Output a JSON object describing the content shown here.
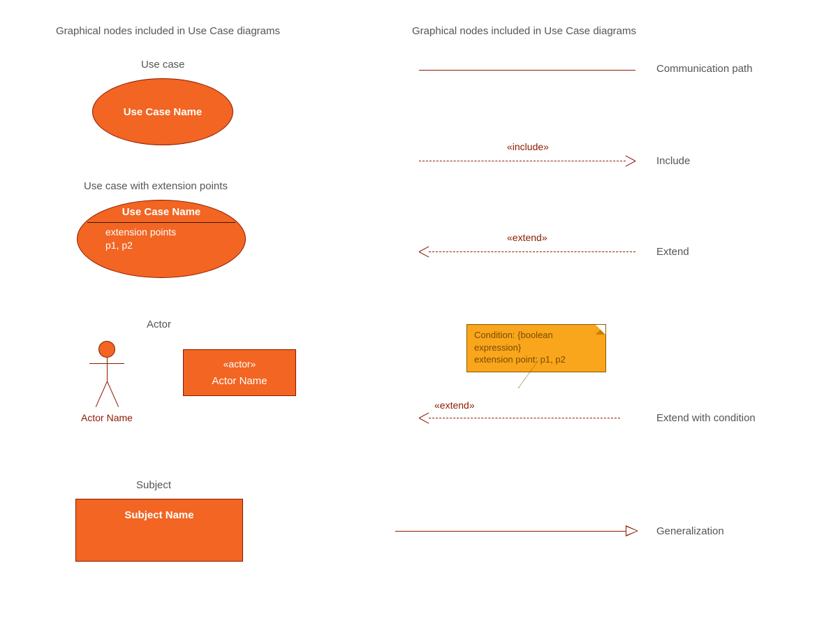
{
  "headings": {
    "left": "Graphical nodes included in Use Case diagrams",
    "right": "Graphical nodes included in Use Case diagrams"
  },
  "left_items": {
    "use_case": {
      "title": "Use case",
      "name": "Use Case Name"
    },
    "use_case_ext": {
      "title": "Use case with extension points",
      "name": "Use Case Name",
      "ext_label": "extension points",
      "ext_list": "p1, p2"
    },
    "actor": {
      "title": "Actor",
      "stick_caption": "Actor Name",
      "stereotype": "«actor»",
      "rect_name": "Actor Name"
    },
    "subject": {
      "title": "Subject",
      "name": "Subject Name"
    }
  },
  "right_items": {
    "communication": {
      "label": "Communication path"
    },
    "include": {
      "stereotype": "«include»",
      "label": "Include"
    },
    "extend": {
      "stereotype": "«extend»",
      "label": "Extend"
    },
    "extend_cond": {
      "note_line1": "Condition: {boolean",
      "note_line2": "expression}",
      "note_line3": "extension point: p1, p2",
      "stereotype": "«extend»",
      "label": "Extend with condition"
    },
    "generalization": {
      "label": "Generalization"
    }
  }
}
